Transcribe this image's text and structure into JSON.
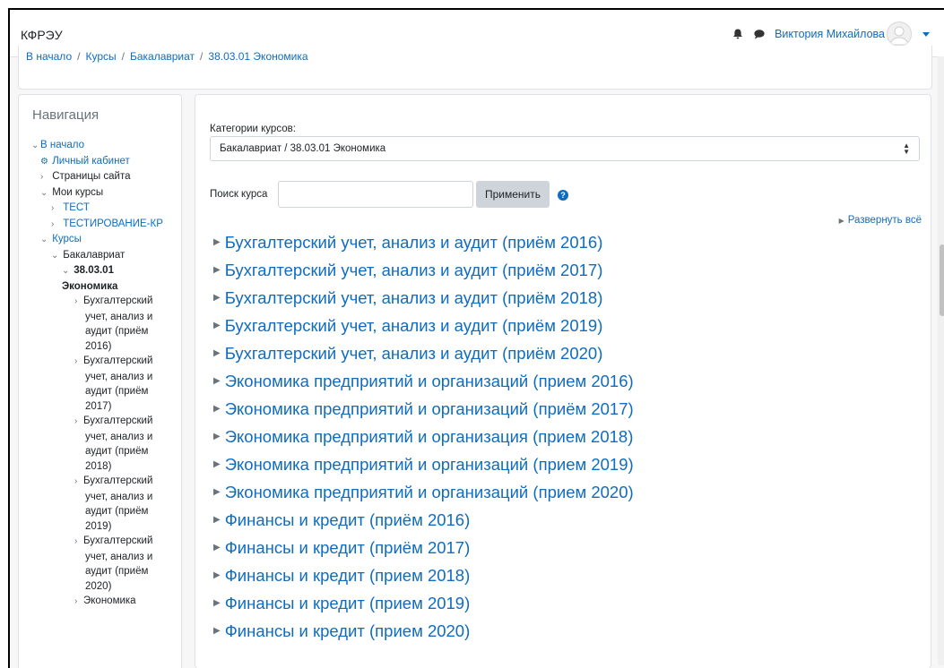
{
  "navbar": {
    "brand": "КФРЭУ",
    "icons": [
      "bell-icon",
      "chat-icon"
    ],
    "user_name": "Виктория Михайлова"
  },
  "breadcrumb": [
    "В начало",
    "Курсы",
    "Бакалавриат",
    "38.03.01 Экономика"
  ],
  "sidebar": {
    "title": "Навигация",
    "home": "В начало",
    "dashboard": "Личный кабинет",
    "site_pages": "Страницы сайта",
    "my_courses": "Мои курсы",
    "my_course_items": [
      "ТЕСТ",
      "ТЕСТИРОВАНИЕ-КР"
    ],
    "courses": "Курсы",
    "bachelor": "Бакалавриат",
    "current_line1": "38.03.01",
    "current_line2": "Экономика",
    "sub_items": [
      [
        "Бухгалтерский",
        "учет, анализ и",
        "аудит (приём",
        "2016)"
      ],
      [
        "Бухгалтерский",
        "учет, анализ и",
        "аудит (приём",
        "2017)"
      ],
      [
        "Бухгалтерский",
        "учет, анализ и",
        "аудит (приём",
        "2018)"
      ],
      [
        "Бухгалтерский",
        "учет, анализ и",
        "аудит (приём",
        "2019)"
      ],
      [
        "Бухгалтерский",
        "учет, анализ и",
        "аудит (приём",
        "2020)"
      ],
      [
        "Экономика"
      ]
    ]
  },
  "main": {
    "category_label": "Категории курсов:",
    "category_value": "Бакалавриат / 38.03.01 Экономика",
    "search_label": "Поиск курса",
    "search_value": "",
    "apply_button": "Применить",
    "help_glyph": "?",
    "expand_all": "Развернуть всё",
    "courses": [
      "Бухгалтерский учет, анализ и аудит (приём 2016)",
      "Бухгалтерский учет, анализ и аудит (приём 2017)",
      "Бухгалтерский учет, анализ и аудит (приём 2018)",
      "Бухгалтерский учет, анализ и аудит (приём 2019)",
      "Бухгалтерский учет, анализ и аудит (приём 2020)",
      "Экономика предприятий и организаций (прием 2016)",
      "Экономика предприятий и организаций (приём 2017)",
      "Экономика предприятий и организация (прием 2018)",
      "Экономика предприятий и организаций (прием 2019)",
      "Экономика предприятий и организаций (прием 2020)",
      "Финансы и кредит (приём 2016)",
      "Финансы и кредит (приём 2017)",
      "Финансы и кредит (прием 2018)",
      "Финансы и кредит (прием 2019)",
      "Финансы и кредит (прием 2020)"
    ]
  },
  "colors": {
    "link": "#0f6cbf",
    "muted": "#6a737b",
    "button_bg": "#ced4da"
  }
}
